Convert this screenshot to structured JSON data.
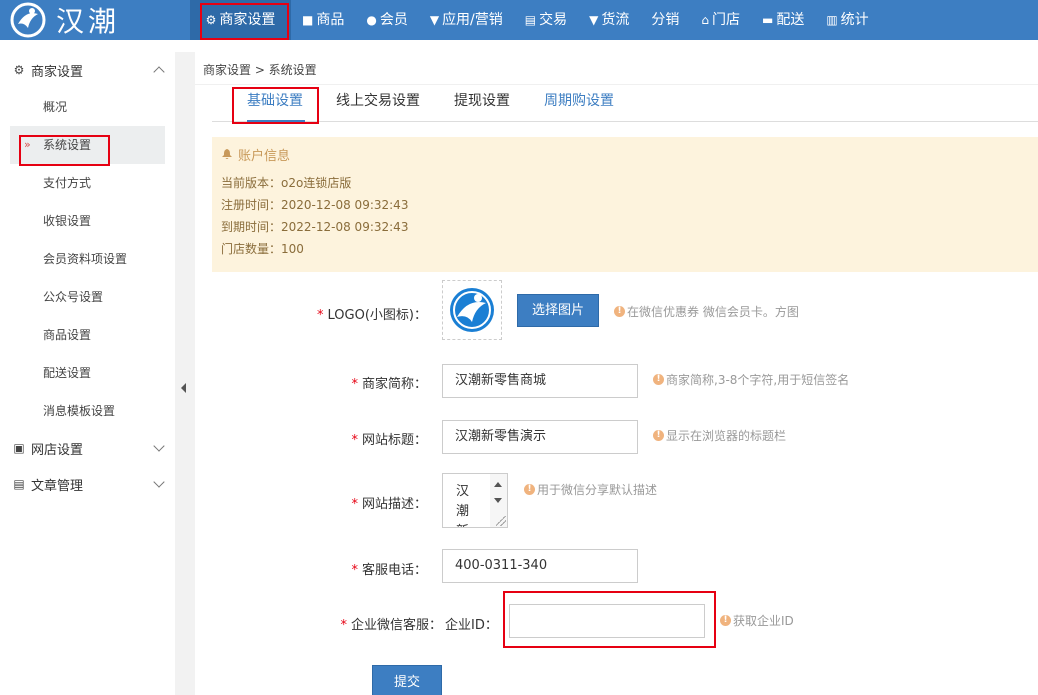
{
  "brand": {
    "name": "汉潮"
  },
  "nav": [
    {
      "label": "商家设置",
      "icon": "gear-icon"
    },
    {
      "label": "商品",
      "icon": "product-icon"
    },
    {
      "label": "会员",
      "icon": "user-icon"
    },
    {
      "label": "应用/营销",
      "icon": "app-icon"
    },
    {
      "label": "交易",
      "icon": "document-icon"
    },
    {
      "label": "货流",
      "icon": "truck-icon"
    },
    {
      "label": "分销",
      "icon": ""
    },
    {
      "label": "门店",
      "icon": "home-icon"
    },
    {
      "label": "配送",
      "icon": "delivery-icon"
    },
    {
      "label": "统计",
      "icon": "bar-chart-icon"
    }
  ],
  "sidebar": {
    "sections": [
      {
        "label": "商家设置",
        "icon": "gear-icon",
        "expanded": true
      },
      {
        "label": "网店设置",
        "icon": "store-icon",
        "expanded": false
      },
      {
        "label": "文章管理",
        "icon": "article-icon",
        "expanded": false
      }
    ],
    "items": [
      {
        "label": "概况"
      },
      {
        "label": "系统设置",
        "active": true
      },
      {
        "label": "支付方式"
      },
      {
        "label": "收银设置"
      },
      {
        "label": "会员资料项设置"
      },
      {
        "label": "公众号设置"
      },
      {
        "label": "商品设置"
      },
      {
        "label": "配送设置"
      },
      {
        "label": "消息模板设置"
      }
    ]
  },
  "breadcrumb": "商家设置 > 系统设置",
  "tabs": [
    {
      "label": "基础设置",
      "active": true
    },
    {
      "label": "线上交易设置"
    },
    {
      "label": "提现设置"
    },
    {
      "label": "周期购设置"
    }
  ],
  "account": {
    "title": "账户信息",
    "lines": [
      "当前版本：o2o连锁店版",
      "注册时间：2020-12-08 09:32:43",
      "到期时间：2022-12-08 09:32:43",
      "门店数量：100"
    ]
  },
  "form": {
    "logo": {
      "label": "LOGO(小图标)：",
      "button": "选择图片",
      "hint": "在微信优惠券 微信会员卡。方图"
    },
    "short_name": {
      "label": "商家简称：",
      "value": "汉潮新零售商城",
      "hint": "商家简称,3-8个字符,用于短信签名"
    },
    "site_title": {
      "label": "网站标题：",
      "value": "汉潮新零售演示",
      "hint": "显示在浏览器的标题栏"
    },
    "site_desc": {
      "label": "网站描述：",
      "value": "汉潮新",
      "hint": "用于微信分享默认描述"
    },
    "phone": {
      "label": "客服电话：",
      "value": "400-0311-340"
    },
    "wecom": {
      "label": "企业微信客服：",
      "sub_label": "企业ID：",
      "value": "",
      "hint": "获取企业ID"
    },
    "submit": "提交"
  },
  "colors": {
    "primary": "#3d7ec2",
    "highlight_box": "#e60012",
    "notice_bg": "#fdf3dd"
  }
}
